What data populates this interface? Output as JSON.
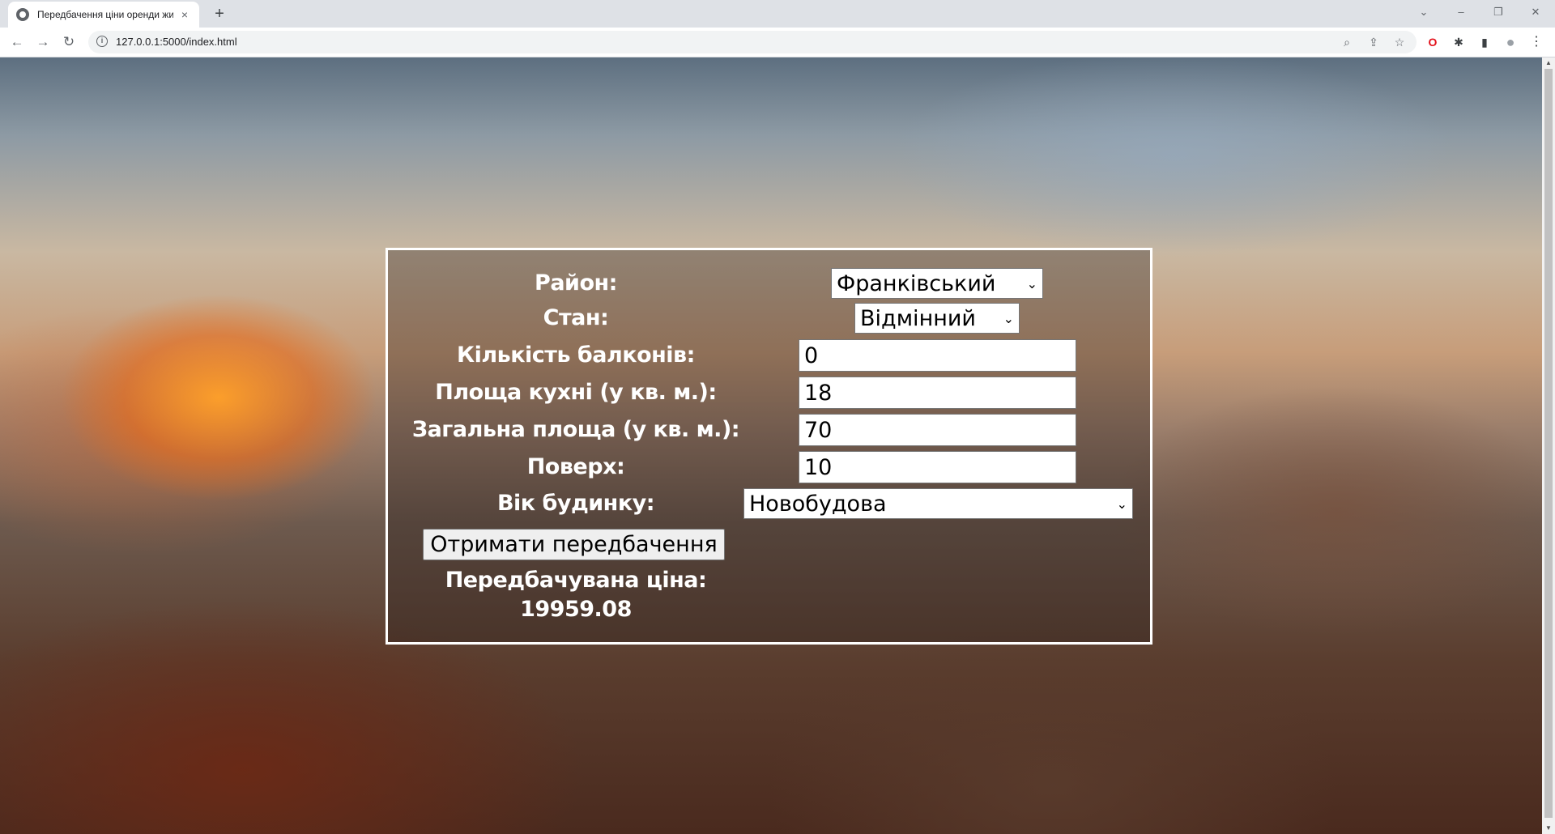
{
  "browser": {
    "tab_title": "Передбачення ціни оренди жи",
    "tab_close": "×",
    "new_tab": "+",
    "url": "127.0.0.1:5000/index.html",
    "window_controls": {
      "tab_search": "⌄",
      "minimize": "–",
      "restore": "❐",
      "close": "✕"
    },
    "nav": {
      "back": "←",
      "forward": "→",
      "reload": "↻"
    },
    "omnibox_icons": {
      "zoom": "⌕",
      "share": "⇪",
      "bookmark": "☆"
    },
    "extensions": {
      "opera": "O",
      "puzzle": "✱",
      "sidepanel": "▮",
      "profile": "●",
      "menu": "⋮"
    }
  },
  "form": {
    "district_label": "Район:",
    "district_value": "Франківський",
    "condition_label": "Стан:",
    "condition_value": "Відмінний",
    "balconies_label": "Кількість балконів:",
    "balconies_value": "0",
    "kitchen_area_label": "Площа кухні (у кв. м.):",
    "kitchen_area_value": "18",
    "total_area_label": "Загальна площа (у кв. м.):",
    "total_area_value": "70",
    "floor_label": "Поверх:",
    "floor_value": "10",
    "building_age_label": "Вік будинку:",
    "building_age_value": "Новобудова",
    "submit_label": "Отримати передбачення",
    "result_label": "Передбачувана ціна:",
    "result_value": "19959.08"
  },
  "colors": {
    "form_border": "#ffffff",
    "text": "#ffffff",
    "chrome_bg": "#dee1e6"
  }
}
